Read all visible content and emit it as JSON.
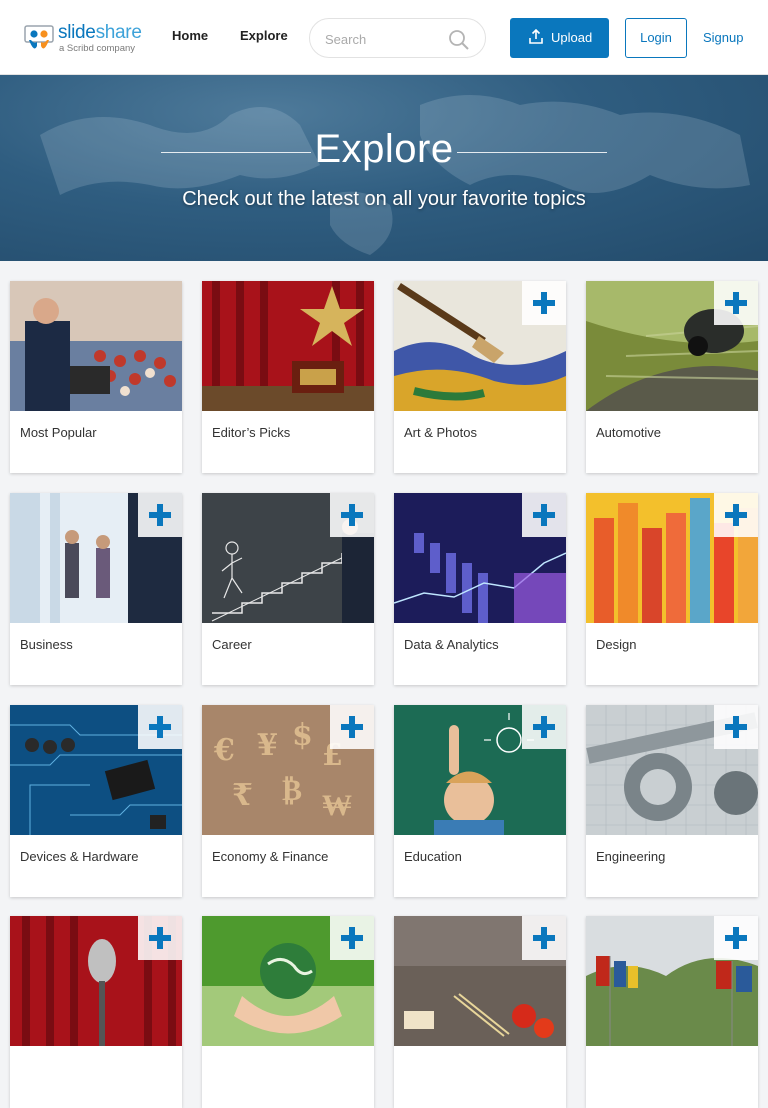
{
  "header": {
    "logo_slide": "slide",
    "logo_share": "share",
    "logo_sub": "a Scribd company",
    "nav": {
      "home": "Home",
      "explore": "Explore"
    },
    "search_placeholder": "Search",
    "upload_label": "Upload",
    "login_label": "Login",
    "signup_label": "Signup"
  },
  "hero": {
    "title": "Explore",
    "subtitle": "Check out the latest on all your favorite topics"
  },
  "colors": {
    "brand": "#0a77bd",
    "hero_bg": "#2f5d80"
  },
  "categories": [
    {
      "title": "Most Popular",
      "image": "conference-audience",
      "follow": false
    },
    {
      "title": "Editor’s Picks",
      "image": "star-trophy",
      "follow": false
    },
    {
      "title": "Art & Photos",
      "image": "paint-brush",
      "follow": true
    },
    {
      "title": "Automotive",
      "image": "car-motion",
      "follow": true
    },
    {
      "title": "Business",
      "image": "office-people",
      "follow": true
    },
    {
      "title": "Career",
      "image": "chalk-stairs",
      "follow": true
    },
    {
      "title": "Data & Analytics",
      "image": "data-graph",
      "follow": true
    },
    {
      "title": "Design",
      "image": "color-stripes",
      "follow": true
    },
    {
      "title": "Devices & Hardware",
      "image": "circuit-board",
      "follow": true
    },
    {
      "title": "Economy & Finance",
      "image": "currency-symbols",
      "follow": true
    },
    {
      "title": "Education",
      "image": "child-chalkboard",
      "follow": true
    },
    {
      "title": "Engineering",
      "image": "caliper-gears",
      "follow": true
    },
    {
      "title": "",
      "image": "microphone-curtain",
      "follow": true
    },
    {
      "title": "",
      "image": "hands-globe",
      "follow": true
    },
    {
      "title": "",
      "image": "food-table",
      "follow": true
    },
    {
      "title": "",
      "image": "flags-plaza",
      "follow": true
    }
  ]
}
